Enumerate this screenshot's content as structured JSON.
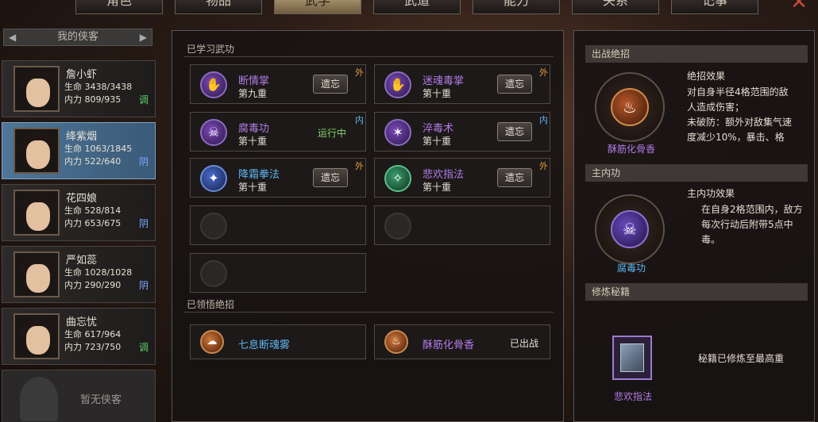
{
  "tabs": [
    "角色",
    "物品",
    "武学",
    "武道",
    "能力",
    "关系",
    "记事"
  ],
  "active_tab_index": 2,
  "sidebar": {
    "header": "我的侠客",
    "characters": [
      {
        "name": "詹小虾",
        "hp": "生命 3438/3438",
        "mp": "内力 809/935",
        "tag": "调",
        "tag_color": "#5bd06a",
        "selected": false
      },
      {
        "name": "绛紫烟",
        "hp": "生命 1063/1845",
        "mp": "内力 522/640",
        "tag": "阴",
        "tag_color": "#7aa8ff",
        "selected": true
      },
      {
        "name": "花四娘",
        "hp": "生命 528/814",
        "mp": "内力 653/675",
        "tag": "阴",
        "tag_color": "#7aa8ff",
        "selected": false
      },
      {
        "name": "严如蕊",
        "hp": "生命 1028/1028",
        "mp": "内力 290/290",
        "tag": "阴",
        "tag_color": "#7aa8ff",
        "selected": false
      },
      {
        "name": "曲忘忧",
        "hp": "生命 617/964",
        "mp": "内力 723/750",
        "tag": "调",
        "tag_color": "#5bd06a",
        "selected": false
      }
    ],
    "empty_label": "暂无侠客"
  },
  "middle": {
    "learned_title": "已学习武功",
    "skills": [
      {
        "name": "断情掌",
        "level": "第九重",
        "action": "遗忘",
        "type": "外",
        "type_color": "#e89a3a",
        "name_color": "purple",
        "icon": "palm-icon",
        "glyph": "✋"
      },
      {
        "name": "迷魂毒掌",
        "level": "第十重",
        "action": "遗忘",
        "type": "外",
        "type_color": "#e89a3a",
        "name_color": "purple",
        "icon": "poison-palm-icon",
        "glyph": "✋"
      },
      {
        "name": "腐毒功",
        "level": "第十重",
        "action": "运行中",
        "type": "内",
        "type_color": "#5fb7f2",
        "name_color": "purple",
        "icon": "skull-icon",
        "glyph": "☠"
      },
      {
        "name": "淬毒术",
        "level": "第十重",
        "action": "遗忘",
        "type": "内",
        "type_color": "#5fb7f2",
        "name_color": "purple",
        "icon": "needles-icon",
        "glyph": "✶"
      },
      {
        "name": "降霜拳法",
        "level": "第十重",
        "action": "遗忘",
        "type": "外",
        "type_color": "#e89a3a",
        "name_color": "blue",
        "icon": "frost-fist-icon",
        "glyph": "✦"
      },
      {
        "name": "悲欢指法",
        "level": "第十重",
        "action": "遗忘",
        "type": "外",
        "type_color": "#e89a3a",
        "name_color": "purple",
        "icon": "finger-icon",
        "glyph": "✧"
      }
    ],
    "ult_title": "已领悟绝招",
    "ults": [
      {
        "name": "七息断魂雾",
        "status": "",
        "name_color": "blue",
        "icon": "mist-icon",
        "glyph": "☁"
      },
      {
        "name": "酥筋化骨香",
        "status": "已出战",
        "name_color": "purple",
        "icon": "incense-icon",
        "glyph": "♨"
      }
    ]
  },
  "right": {
    "ult_section": "出战绝招",
    "ult_name": "酥筋化骨香",
    "ult_effect_title": "绝招效果",
    "ult_effect_lines": [
      "对自身半径4格范围的敌",
      "人造成伤害；",
      "未破防：额外对敌集气速",
      "度减少10%，暴击、格"
    ],
    "main_section": "主内功",
    "main_name": "腐毒功",
    "main_effect_title": "主内功效果",
    "main_effect_lines": [
      "在自身2格范围内，敌方",
      "每次行动后附带5点中",
      "毒。"
    ],
    "book_section": "修炼秘籍",
    "book_name": "悲欢指法",
    "book_status": "秘籍已修炼至最高重"
  }
}
